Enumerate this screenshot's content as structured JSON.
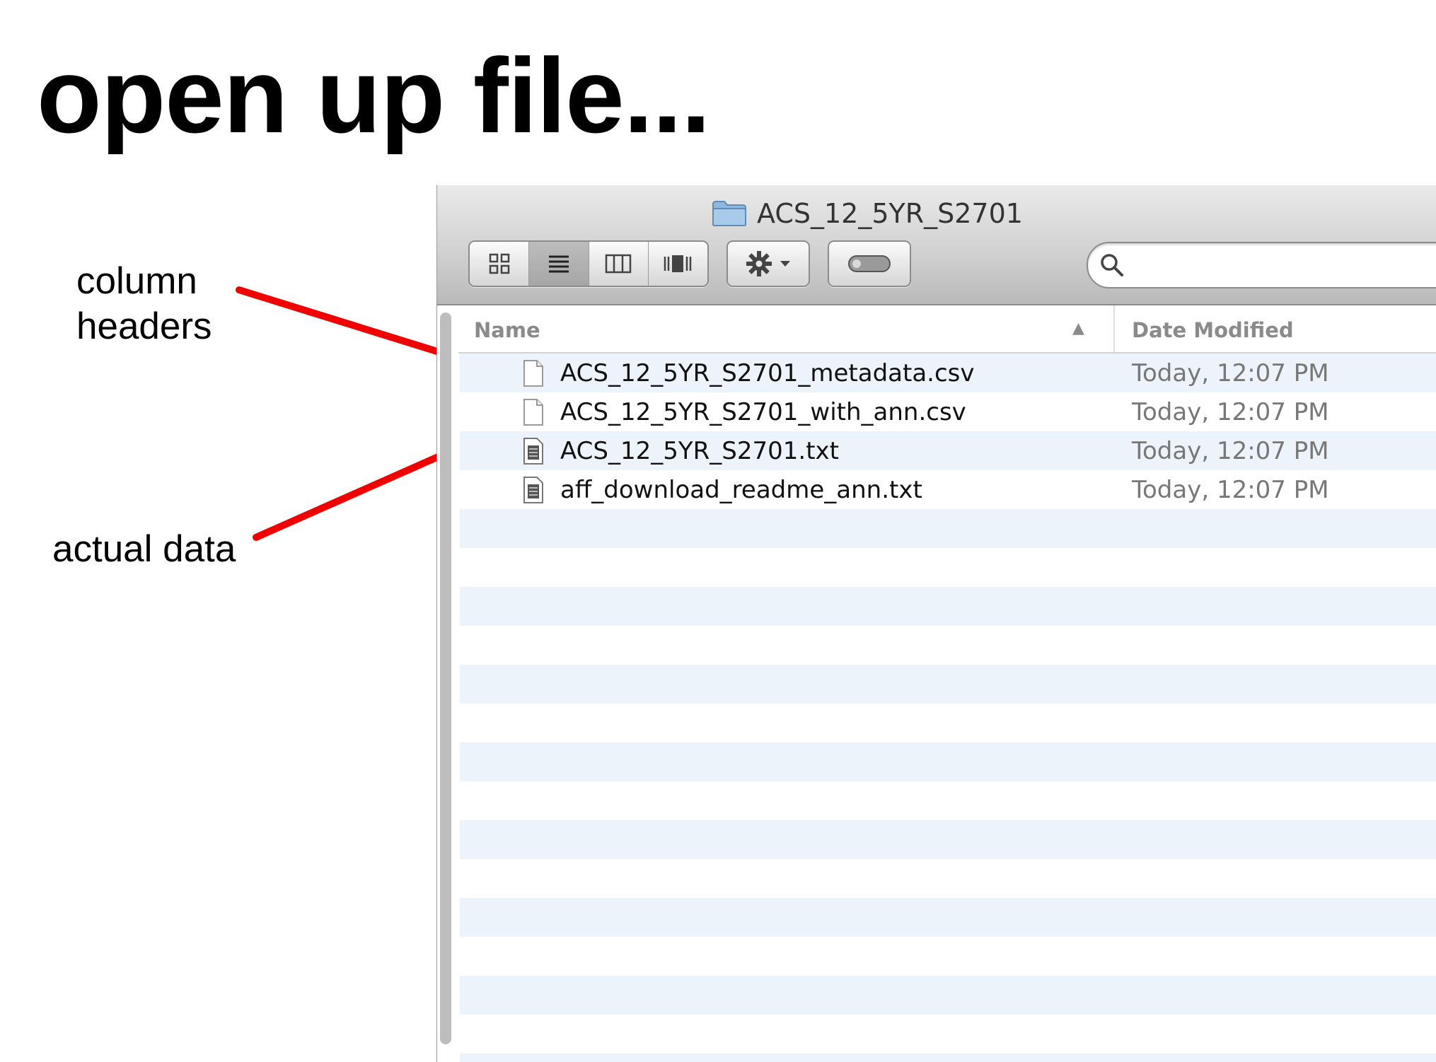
{
  "slide": {
    "title": "open up file...",
    "annotations": [
      "column\nheaders",
      "actual data"
    ]
  },
  "window": {
    "title": "ACS_12_5YR_S2701",
    "search_placeholder": ""
  },
  "columns": {
    "name": "Name",
    "date": "Date Modified"
  },
  "files": [
    {
      "name": "ACS_12_5YR_S2701_metadata.csv",
      "date": "Today, 12:07 PM",
      "icon": "blank-document-icon"
    },
    {
      "name": "ACS_12_5YR_S2701_with_ann.csv",
      "date": "Today, 12:07 PM",
      "icon": "blank-document-icon"
    },
    {
      "name": "ACS_12_5YR_S2701.txt",
      "date": "Today, 12:07 PM",
      "icon": "text-document-icon"
    },
    {
      "name": "aff_download_readme_ann.txt",
      "date": "Today, 12:07 PM",
      "icon": "text-document-icon"
    }
  ],
  "colors": {
    "arrow": "#f00000",
    "row_stripe": "#edf3fb",
    "header_text": "#8a8a8a"
  }
}
